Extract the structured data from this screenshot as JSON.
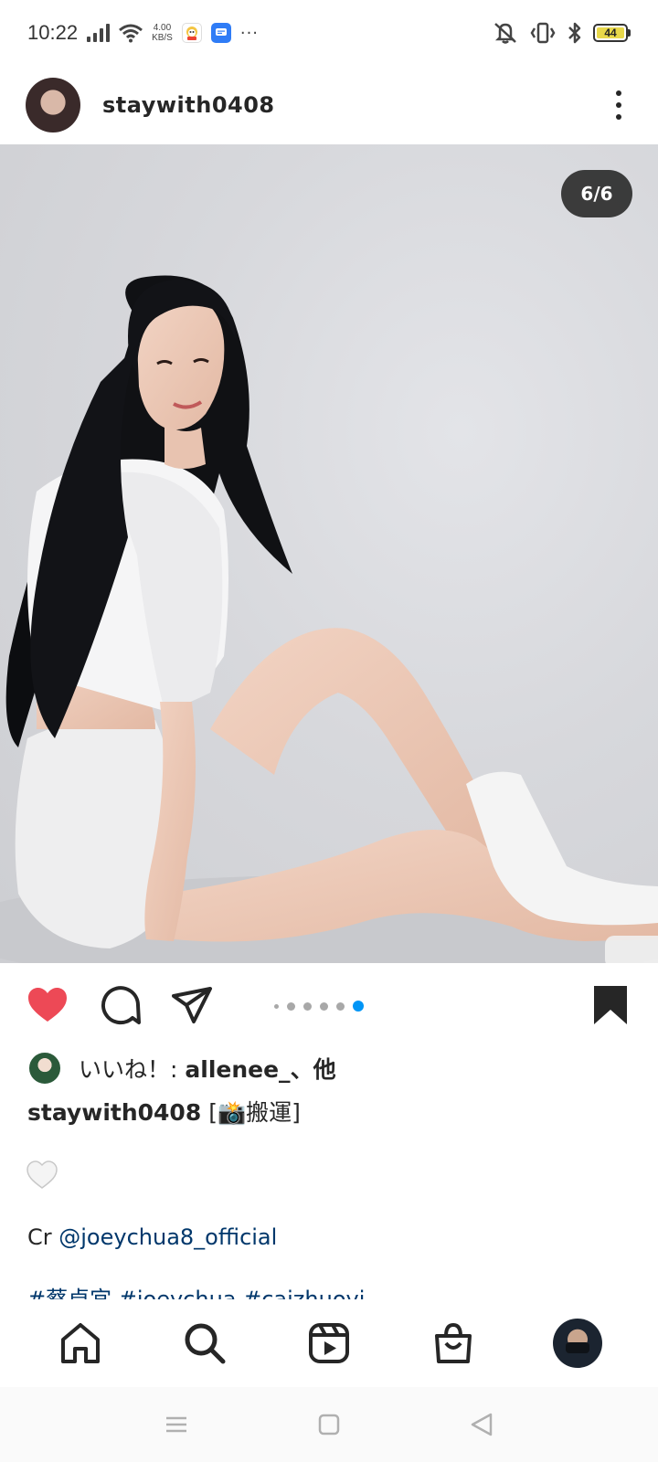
{
  "status_bar": {
    "time": "10:22",
    "net_speed_value": "4.00",
    "net_speed_unit": "KB/S",
    "more": "···",
    "battery": "44"
  },
  "post": {
    "username": "staywith0408",
    "image_counter": "6/6",
    "carousel": {
      "total": 6,
      "active": 6
    },
    "liked": true,
    "saved": true,
    "likes": {
      "prefix": "いいね！: ",
      "user": "allenee_",
      "suffix": "、他"
    },
    "caption": {
      "user": "staywith0408",
      "text": "[📸搬運]"
    },
    "credit_prefix": "Cr ",
    "credit_mention": "@joeychua8_official",
    "tags": "#蔡卓宜 #joeychua #caizhuoyi"
  },
  "colors": {
    "like_red": "#ed4956",
    "link_blue": "#00376b",
    "active_dot": "#0095f6",
    "battery_yellow": "#e8d84a"
  },
  "bottom_nav": [
    "home-icon",
    "search-icon",
    "reels-icon",
    "shop-icon",
    "profile-avatar"
  ],
  "system_nav": [
    "menu-icon",
    "home-square-icon",
    "back-icon"
  ]
}
